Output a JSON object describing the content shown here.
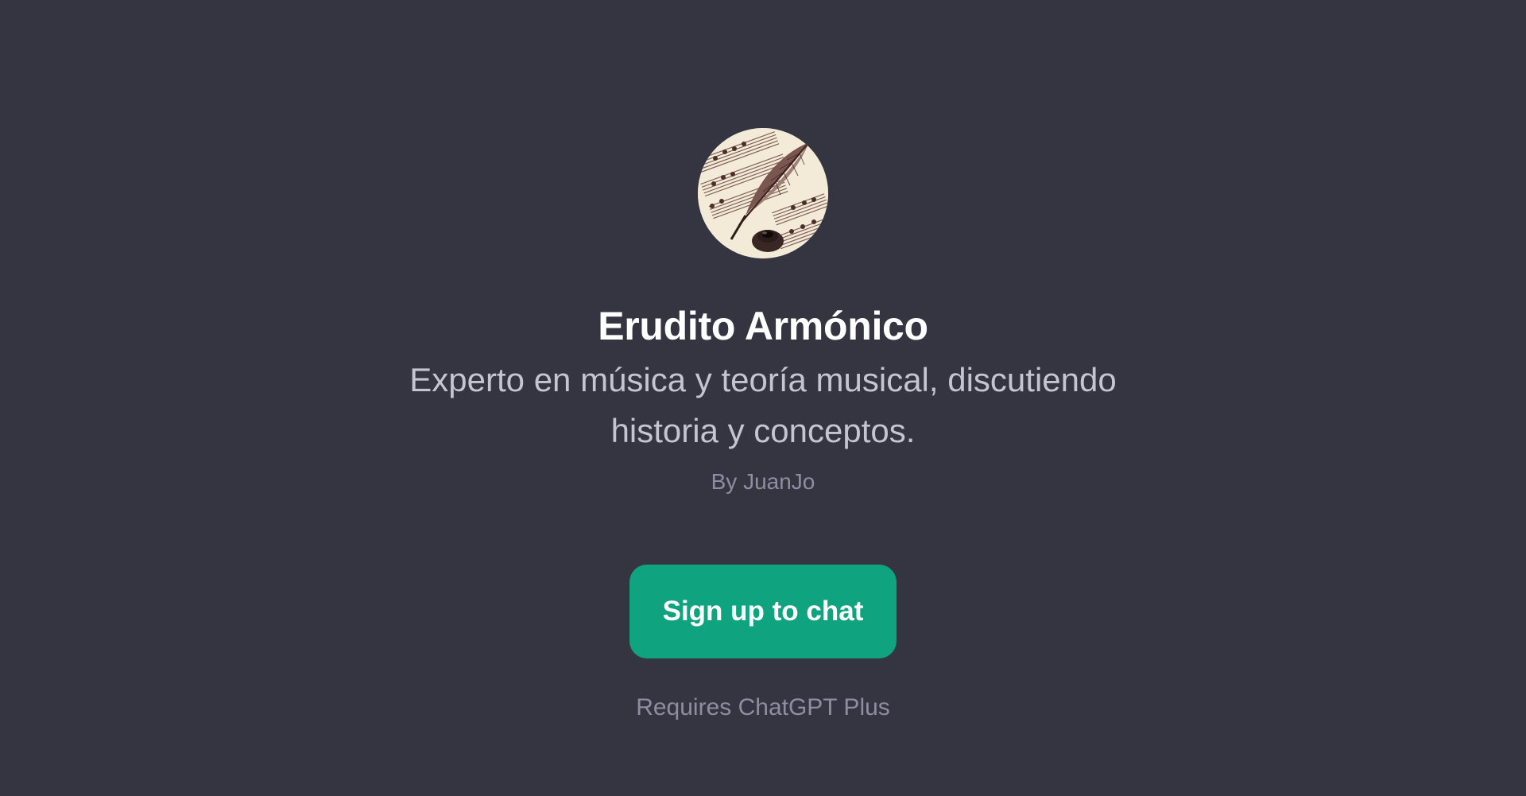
{
  "gpt": {
    "avatar_icon": "quill-and-sheet-music-icon",
    "name": "Erudito Armónico",
    "description": "Experto en música y teoría musical, discutiendo historia y conceptos.",
    "author": "By JuanJo"
  },
  "actions": {
    "signup_label": "Sign up to chat",
    "requirement": "Requires ChatGPT Plus"
  },
  "colors": {
    "background": "#343541",
    "accent": "#10a37f",
    "title": "#ffffff",
    "description": "#c5c5d2",
    "muted": "#8e8ea0"
  }
}
